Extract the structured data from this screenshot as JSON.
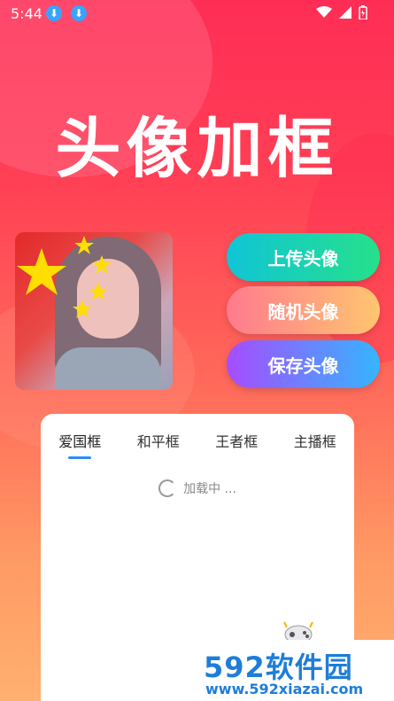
{
  "status": {
    "time": "5:44"
  },
  "title": "头像加框",
  "buttons": {
    "upload": "上传头像",
    "random": "随机头像",
    "save": "保存头像"
  },
  "tabs": [
    {
      "label": "爱国框",
      "active": true
    },
    {
      "label": "和平框",
      "active": false
    },
    {
      "label": "王者框",
      "active": false
    },
    {
      "label": "主播框",
      "active": false
    }
  ],
  "loading_text": "加载中 ...",
  "watermark": {
    "main": "592软件园",
    "sub": "www.592xiazai.com"
  },
  "colors": {
    "accent_blue": "#2d8cf0",
    "flag_red": "#e32a2a",
    "star_yellow": "#ffde00"
  },
  "icons": [
    "download-icon",
    "wifi-icon",
    "signal-icon",
    "battery-icon",
    "star-icon",
    "gamepad-icon",
    "spinner-icon"
  ]
}
